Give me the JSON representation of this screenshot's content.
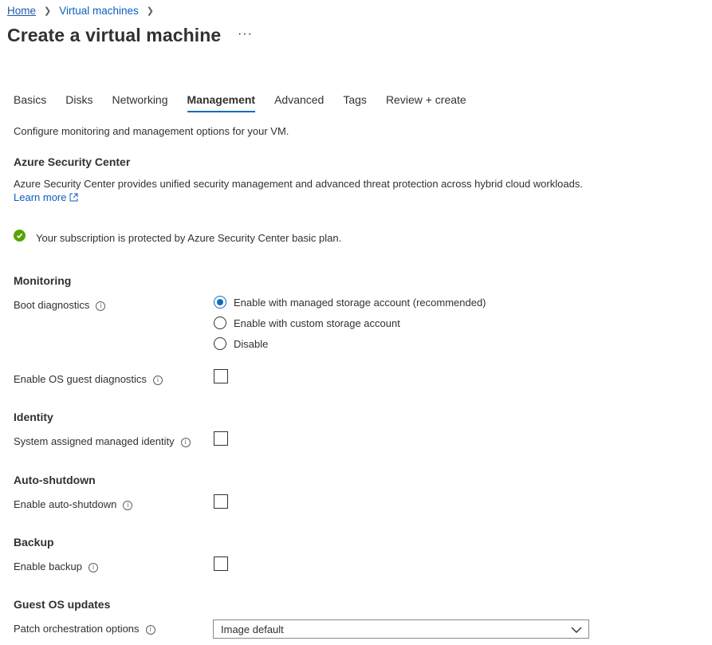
{
  "breadcrumb": {
    "home": "Home",
    "current": "Virtual machines"
  },
  "page": {
    "title": "Create a virtual machine",
    "more": "···"
  },
  "tabs": [
    {
      "label": "Basics"
    },
    {
      "label": "Disks"
    },
    {
      "label": "Networking"
    },
    {
      "label": "Management",
      "active": true
    },
    {
      "label": "Advanced"
    },
    {
      "label": "Tags"
    },
    {
      "label": "Review + create"
    }
  ],
  "intro": "Configure monitoring and management options for your VM.",
  "security": {
    "heading": "Azure Security Center",
    "description": "Azure Security Center provides unified security management and advanced threat protection across hybrid cloud workloads.",
    "learn_more": "Learn more",
    "status": "Your subscription is protected by Azure Security Center basic plan."
  },
  "monitoring": {
    "heading": "Monitoring",
    "boot_label": "Boot diagnostics",
    "boot_options": [
      {
        "label": "Enable with managed storage account (recommended)",
        "checked": true
      },
      {
        "label": "Enable with custom storage account",
        "checked": false
      },
      {
        "label": "Disable",
        "checked": false
      }
    ],
    "os_guest_label": "Enable OS guest diagnostics"
  },
  "identity": {
    "heading": "Identity",
    "label": "System assigned managed identity"
  },
  "autoshutdown": {
    "heading": "Auto-shutdown",
    "label": "Enable auto-shutdown"
  },
  "backup": {
    "heading": "Backup",
    "label": "Enable backup"
  },
  "guest_updates": {
    "heading": "Guest OS updates",
    "label": "Patch orchestration options",
    "selected": "Image default"
  },
  "colors": {
    "accent": "#0f6cbd",
    "link": "#0a5fbf",
    "success": "#57a300"
  }
}
